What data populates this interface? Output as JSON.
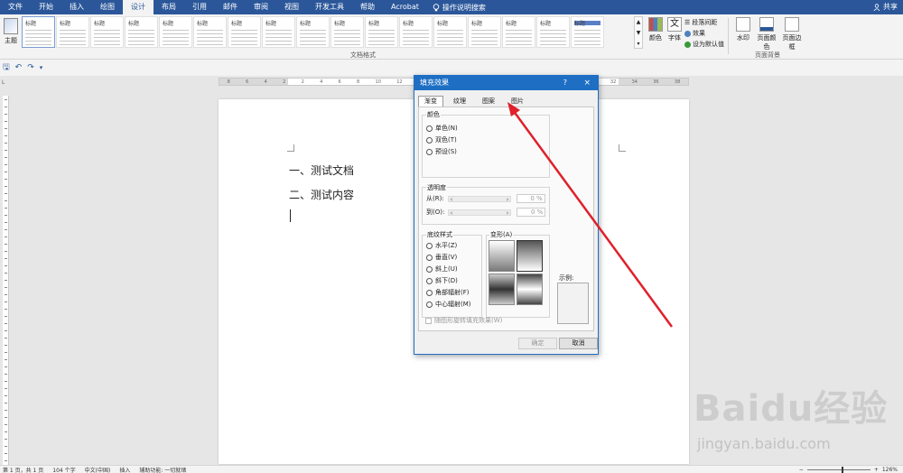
{
  "menubar": {
    "tabs": [
      "文件",
      "开始",
      "插入",
      "绘图",
      "设计",
      "布局",
      "引用",
      "邮件",
      "审阅",
      "视图",
      "开发工具",
      "帮助",
      "Acrobat"
    ],
    "active_tab": "设计",
    "search_label": "操作说明搜索",
    "share_label": "共享"
  },
  "ribbon": {
    "theme_label": "主题",
    "style_titles": [
      "标题",
      "标题",
      "标题",
      "标题",
      "标题",
      "标题",
      "标题",
      "标题",
      "标题",
      "标题",
      "标题",
      "标题",
      "标题",
      "标题",
      "标题",
      "标题",
      "标题"
    ],
    "group_doc_format": "文档格式",
    "colors_label": "颜色",
    "fonts_label": "字体",
    "paragraph_spacing": "段落间距",
    "effects": "效果",
    "set_default": "设为默认值",
    "watermark_label": "水印",
    "page_color_label": "页面颜色",
    "page_border_label": "页面边框",
    "group_page_background": "页面背景"
  },
  "document": {
    "line1": "一、测试文档",
    "line2": "二、测试内容"
  },
  "dialog": {
    "title": "填充效果",
    "help": "?",
    "close": "×",
    "tabs": [
      "渐变",
      "纹理",
      "图案",
      "图片"
    ],
    "active_tab": "渐变",
    "colors_legend": "颜色",
    "color_options": [
      "单色(N)",
      "双色(T)",
      "预设(S)"
    ],
    "transparency_legend": "透明度",
    "from_label": "从(R):",
    "to_label": "到(O):",
    "from_value": "0 %",
    "to_value": "0 %",
    "shading_legend": "底纹样式",
    "shading_options": [
      "水平(Z)",
      "垂直(V)",
      "斜上(U)",
      "斜下(D)",
      "角部辐射(F)",
      "中心辐射(M)"
    ],
    "variants_legend": "变形(A)",
    "sample_label": "示例:",
    "rotate_checkbox": "随图形旋转填充效果(W)",
    "ok": "确定",
    "cancel": "取消"
  },
  "statusbar": {
    "page": "第 1 页，共 1 页",
    "words": "104 个字",
    "language": "中文(中国)",
    "mode": "插入",
    "accessibility": "辅助功能: 一切就绪",
    "zoom": "126%"
  },
  "watermark": {
    "logo": "Baidu经验",
    "url": "jingyan.baidu.com"
  },
  "colors": {
    "accent": "#2b579a",
    "dialog_title": "#1e6fc4",
    "arrow": "#e0202a"
  }
}
